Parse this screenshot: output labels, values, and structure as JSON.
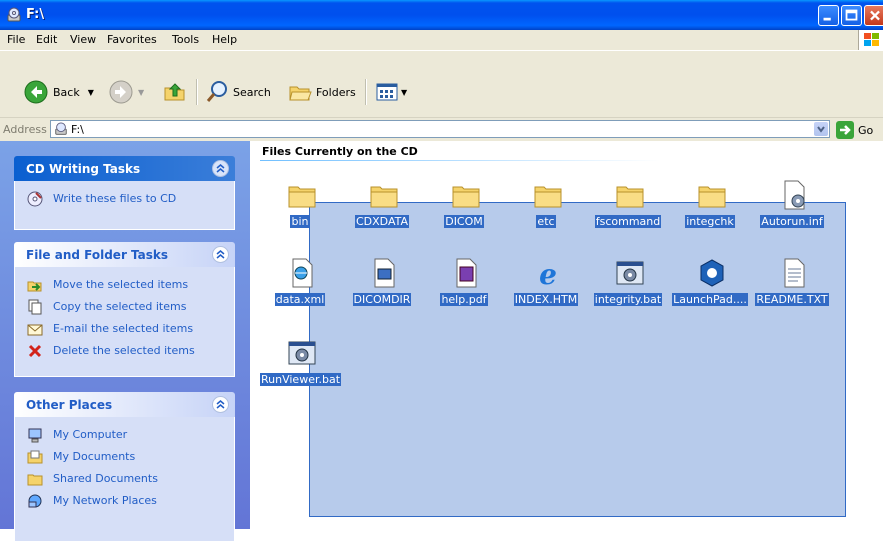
{
  "window": {
    "title": "F:\\",
    "icon": "cd-drive-icon"
  },
  "menu": [
    "File",
    "Edit",
    "View",
    "Favorites",
    "Tools",
    "Help"
  ],
  "toolbar": {
    "back_label": "Back",
    "search_label": "Search",
    "folders_label": "Folders"
  },
  "address": {
    "label": "Address",
    "value": "F:\\",
    "go_label": "Go"
  },
  "tasks": {
    "cd_writing": {
      "title": "CD Writing Tasks",
      "items": [
        {
          "label": "Write these files to CD",
          "icon": "write-cd-icon"
        }
      ]
    },
    "file_folder": {
      "title": "File and Folder Tasks",
      "items": [
        {
          "label": "Move the selected items",
          "icon": "move-icon"
        },
        {
          "label": "Copy the selected items",
          "icon": "copy-icon"
        },
        {
          "label": "E-mail the selected items",
          "icon": "email-icon"
        },
        {
          "label": "Delete the selected items",
          "icon": "delete-icon"
        }
      ]
    },
    "other_places": {
      "title": "Other Places",
      "items": [
        {
          "label": "My Computer",
          "icon": "computer-icon"
        },
        {
          "label": "My Documents",
          "icon": "documents-icon"
        },
        {
          "label": "Shared Documents",
          "icon": "shared-folder-icon"
        },
        {
          "label": "My Network Places",
          "icon": "network-icon"
        }
      ]
    }
  },
  "content": {
    "section_title": "Files Currently on the CD",
    "files": [
      {
        "name": "bin",
        "icon": "folder-icon"
      },
      {
        "name": "CDXDATA",
        "icon": "folder-icon"
      },
      {
        "name": "DICOM",
        "icon": "folder-icon"
      },
      {
        "name": "etc",
        "icon": "folder-icon"
      },
      {
        "name": "fscommand",
        "icon": "folder-icon"
      },
      {
        "name": "integchk",
        "icon": "folder-icon"
      },
      {
        "name": "Autorun.inf",
        "icon": "settings-file-icon"
      },
      {
        "name": "data.xml",
        "icon": "xml-file-icon"
      },
      {
        "name": "DICOMDIR",
        "icon": "generic-file-icon"
      },
      {
        "name": "help.pdf",
        "icon": "pdf-file-icon"
      },
      {
        "name": "INDEX.HTM",
        "icon": "ie-html-icon"
      },
      {
        "name": "integrity.bat",
        "icon": "batch-file-icon"
      },
      {
        "name": "LaunchPad....",
        "icon": "launchpad-icon"
      },
      {
        "name": "README.TXT",
        "icon": "text-file-icon"
      },
      {
        "name": "RunViewer.bat",
        "icon": "batch-file-icon"
      }
    ]
  }
}
